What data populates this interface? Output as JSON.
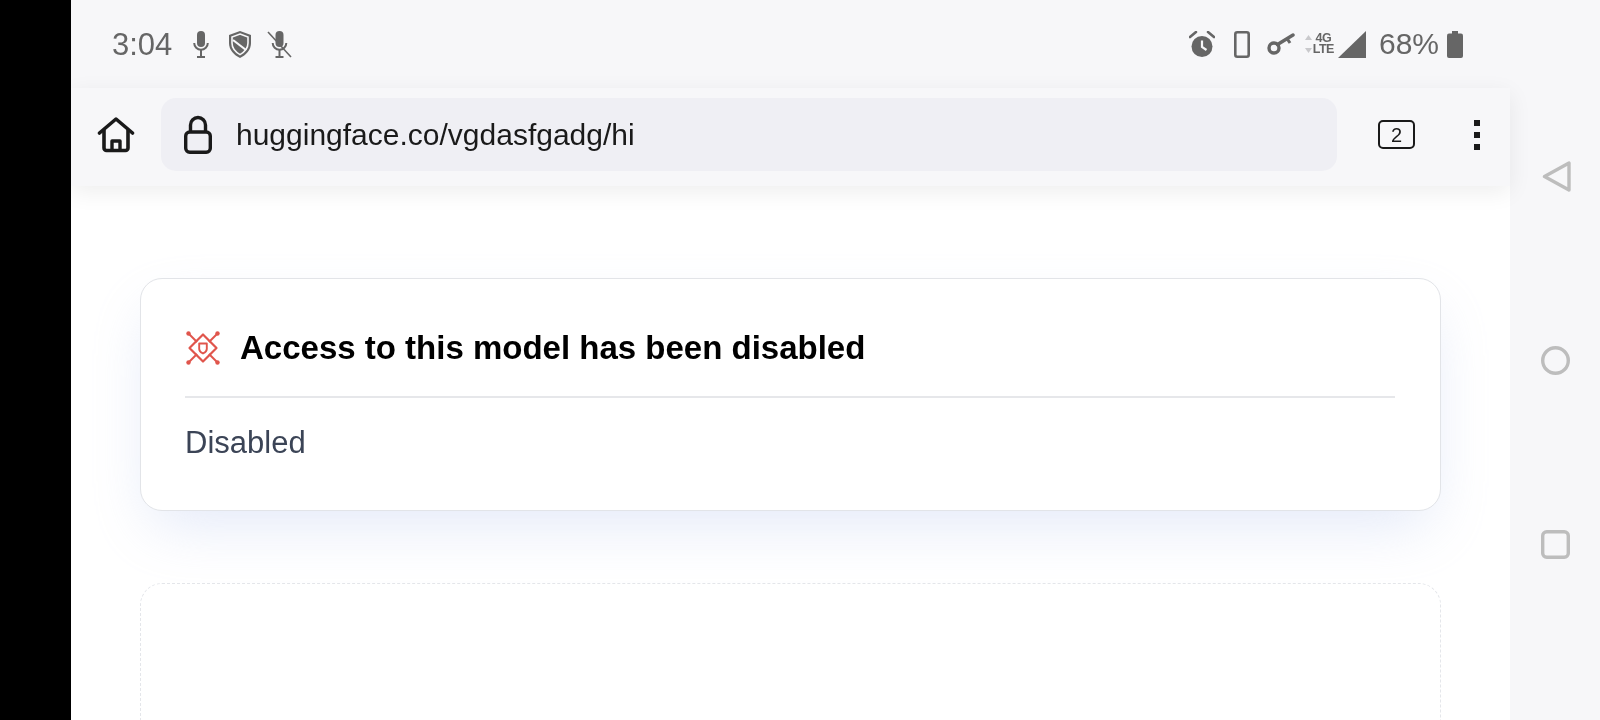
{
  "status_bar": {
    "time": "3:04",
    "network_type": [
      "4G",
      "LTE"
    ],
    "battery": "68%"
  },
  "browser_toolbar": {
    "url": "huggingface.co/vgdasfgadg/hi",
    "tab_count": "2"
  },
  "notice": {
    "title": "Access to this model has been disabled",
    "message": "Disabled"
  }
}
